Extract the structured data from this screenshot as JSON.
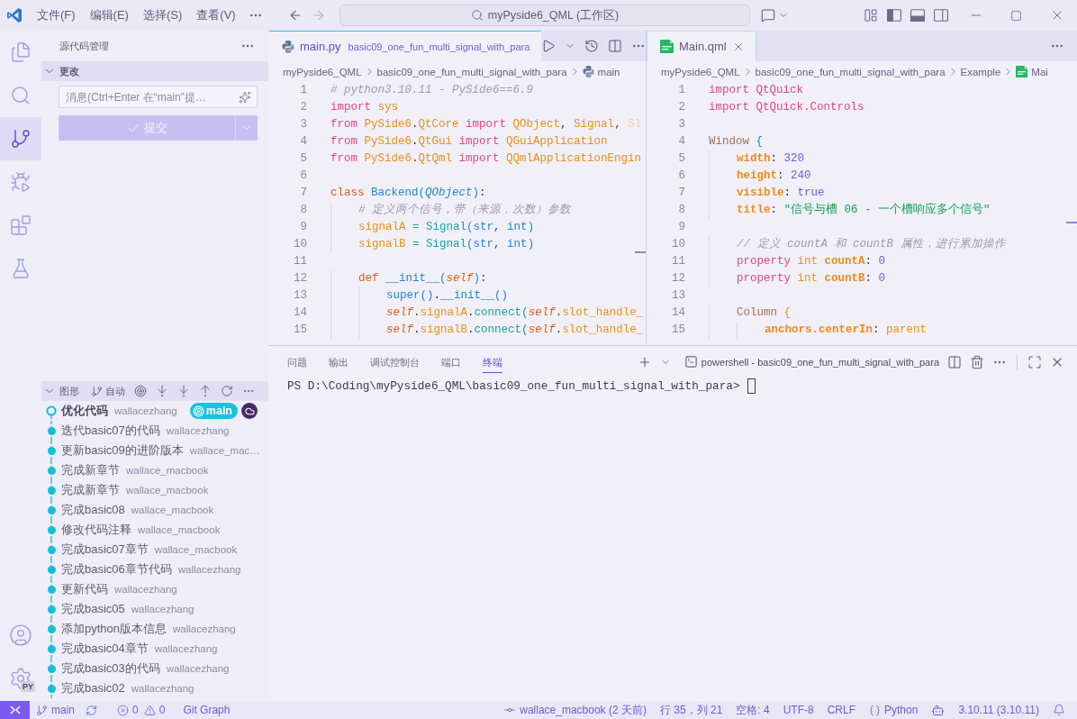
{
  "title_bar": {
    "menus": [
      "文件(F)",
      "编辑(E)",
      "选择(S)",
      "查看(V)"
    ],
    "search": "myPyside6_QML (工作区)"
  },
  "activity_bar": {
    "items": [
      {
        "kind": "explorer",
        "selected": false
      },
      {
        "kind": "search",
        "selected": false
      },
      {
        "kind": "source-control",
        "selected": true
      },
      {
        "kind": "run-debug",
        "selected": false
      },
      {
        "kind": "extensions",
        "selected": false
      },
      {
        "kind": "testing",
        "selected": false
      }
    ],
    "settings_badge": "PY"
  },
  "sidebar": {
    "title": "源代码管理",
    "changes": {
      "label": "更改",
      "expanded": true,
      "message": {
        "placeholder": "消息(Ctrl+Enter 在“main”提…"
      },
      "commit_button": {
        "label": "提交",
        "disabled": true
      }
    },
    "graph": {
      "label": "图形",
      "expanded": true,
      "branch_filter": "自动",
      "commits": [
        {
          "message": "优化代码",
          "author": "wallacezhang",
          "head": true,
          "refs": [
            {
              "kind": "branch",
              "label": "main"
            },
            {
              "kind": "remote"
            }
          ]
        },
        {
          "message": "迭代basic07的代码",
          "author": "wallacezhang",
          "head": false
        },
        {
          "message": "更新basic09的进阶版本",
          "author": "wallace_mac…",
          "head": false
        },
        {
          "message": "完成新章节",
          "author": "wallace_macbook",
          "head": false
        },
        {
          "message": "完成新章节",
          "author": "wallace_macbook",
          "head": false
        },
        {
          "message": "完成basic08",
          "author": "wallace_macbook",
          "head": false
        },
        {
          "message": "修改代码注释",
          "author": "wallace_macbook",
          "head": false
        },
        {
          "message": "完成basic07章节",
          "author": "wallace_macbook",
          "head": false
        },
        {
          "message": "完成basic06章节代码",
          "author": "wallacezhang",
          "head": false
        },
        {
          "message": "更新代码",
          "author": "wallacezhang",
          "head": false
        },
        {
          "message": "完成basic05",
          "author": "wallacezhang",
          "head": false
        },
        {
          "message": "添加python版本信息",
          "author": "wallacezhang",
          "head": false
        },
        {
          "message": "完成basic04章节",
          "author": "wallacezhang",
          "head": false
        },
        {
          "message": "完成basic03的代码",
          "author": "wallacezhang",
          "head": false
        },
        {
          "message": "完成basic02",
          "author": "wallacezhang",
          "head": false
        }
      ]
    }
  },
  "editors": [
    {
      "focused": true,
      "tab": {
        "name": "main.py",
        "description": "basic09_one_fun_multi_signal_with_para",
        "kind": "python",
        "selected": true,
        "closable": false
      },
      "breadcrumbs": [
        {
          "label": "myPyside6_QML"
        },
        {
          "label": "basic09_one_fun_multi_signal_with_para"
        },
        {
          "label": "main",
          "kind": "python"
        }
      ],
      "lines": [
        {
          "number": "1",
          "tokens": [
            {
              "kind": "comment",
              "text": "# python3.10.11 - PySide6==6.9"
            }
          ]
        },
        {
          "number": "2",
          "tokens": [
            {
              "kind": "keyword",
              "text": "import "
            },
            {
              "kind": "module",
              "text": "sys"
            }
          ]
        },
        {
          "number": "3",
          "tokens": [
            {
              "kind": "keyword",
              "text": "from "
            },
            {
              "kind": "module",
              "text": "PySide6"
            },
            {
              "kind": "punct",
              "text": "."
            },
            {
              "kind": "module",
              "text": "QtCore "
            },
            {
              "kind": "keyword",
              "text": "import "
            },
            {
              "kind": "module",
              "text": "QObject"
            },
            {
              "kind": "punct",
              "text": ", "
            },
            {
              "kind": "module",
              "text": "Signal"
            },
            {
              "kind": "punct",
              "text": ", "
            },
            {
              "kind": "faded",
              "text": "Sl"
            }
          ]
        },
        {
          "number": "4",
          "tokens": [
            {
              "kind": "keyword",
              "text": "from "
            },
            {
              "kind": "module",
              "text": "PySide6"
            },
            {
              "kind": "punct",
              "text": "."
            },
            {
              "kind": "module",
              "text": "QtGui "
            },
            {
              "kind": "keyword",
              "text": "import "
            },
            {
              "kind": "module",
              "text": "QGuiApplication"
            }
          ]
        },
        {
          "number": "5",
          "tokens": [
            {
              "kind": "keyword",
              "text": "from "
            },
            {
              "kind": "module",
              "text": "PySide6"
            },
            {
              "kind": "punct",
              "text": "."
            },
            {
              "kind": "module",
              "text": "QtQml "
            },
            {
              "kind": "keyword",
              "text": "import "
            },
            {
              "kind": "module",
              "text": "QQmlApplicationEngin"
            }
          ]
        },
        {
          "number": "6"
        },
        {
          "number": "7",
          "tokens": [
            {
              "kind": "storage",
              "text": "class "
            },
            {
              "kind": "classname",
              "text": "Backend"
            },
            {
              "kind": "paren",
              "text": "("
            },
            {
              "kind": "type",
              "text": "QObject"
            },
            {
              "kind": "paren",
              "text": ")"
            },
            {
              "kind": "punct",
              "text": ":"
            }
          ]
        },
        {
          "number": "8",
          "tokens": [
            {
              "kind": "comment",
              "text": "    # 定义两个信号，带（来源，次数）参数"
            }
          ]
        },
        {
          "number": "9",
          "tokens": [
            {
              "kind": "variable",
              "text": "    signalA"
            },
            {
              "kind": "operator",
              "text": " = "
            },
            {
              "kind": "function",
              "text": "Signal"
            },
            {
              "kind": "paren",
              "text": "("
            },
            {
              "kind": "builtin",
              "text": "str"
            },
            {
              "kind": "punct",
              "text": ", "
            },
            {
              "kind": "builtin",
              "text": "int"
            },
            {
              "kind": "paren",
              "text": ")"
            }
          ]
        },
        {
          "number": "10",
          "tokens": [
            {
              "kind": "variable",
              "text": "    signalB"
            },
            {
              "kind": "operator",
              "text": " = "
            },
            {
              "kind": "function",
              "text": "Signal"
            },
            {
              "kind": "paren",
              "text": "("
            },
            {
              "kind": "builtin",
              "text": "str"
            },
            {
              "kind": "punct",
              "text": ", "
            },
            {
              "kind": "builtin",
              "text": "int"
            },
            {
              "kind": "paren",
              "text": ")"
            }
          ]
        },
        {
          "number": "11"
        },
        {
          "number": "12",
          "tokens": [
            {
              "kind": "storage",
              "text": "    def "
            },
            {
              "kind": "builtin",
              "text": "__init__"
            },
            {
              "kind": "paren",
              "text": "("
            },
            {
              "kind": "self",
              "text": "self"
            },
            {
              "kind": "paren",
              "text": ")"
            },
            {
              "kind": "punct",
              "text": ":"
            }
          ]
        },
        {
          "number": "13",
          "tokens": [
            {
              "kind": "builtin",
              "text": "        super"
            },
            {
              "kind": "paren",
              "text": "()"
            },
            {
              "kind": "punct",
              "text": "."
            },
            {
              "kind": "builtin",
              "text": "__init__"
            },
            {
              "kind": "paren",
              "text": "()"
            }
          ]
        },
        {
          "number": "14",
          "tokens": [
            {
              "kind": "self",
              "text": "        self"
            },
            {
              "kind": "punct",
              "text": "."
            },
            {
              "kind": "variable",
              "text": "signalA"
            },
            {
              "kind": "punct",
              "text": "."
            },
            {
              "kind": "function",
              "text": "connect"
            },
            {
              "kind": "paren",
              "text": "("
            },
            {
              "kind": "self",
              "text": "self"
            },
            {
              "kind": "punct",
              "text": "."
            },
            {
              "kind": "variable",
              "text": "slot_handle_"
            }
          ]
        },
        {
          "number": "15",
          "tokens": [
            {
              "kind": "self",
              "text": "        self"
            },
            {
              "kind": "punct",
              "text": "."
            },
            {
              "kind": "variable",
              "text": "signalB"
            },
            {
              "kind": "punct",
              "text": "."
            },
            {
              "kind": "function",
              "text": "connect"
            },
            {
              "kind": "paren",
              "text": "("
            },
            {
              "kind": "self",
              "text": "self"
            },
            {
              "kind": "punct",
              "text": "."
            },
            {
              "kind": "variable",
              "text": "slot_handle_"
            }
          ]
        }
      ]
    },
    {
      "focused": false,
      "tab": {
        "name": "Main.qml",
        "kind": "qml",
        "selected": true,
        "closable": true
      },
      "breadcrumbs": [
        {
          "label": "myPyside6_QML"
        },
        {
          "label": "basic09_one_fun_multi_signal_with_para"
        },
        {
          "label": "Example"
        },
        {
          "label": "Mai",
          "kind": "qml"
        }
      ],
      "lines": [
        {
          "number": "1",
          "tokens": [
            {
              "kind": "keyword",
              "text": "import "
            },
            {
              "kind": "namespace",
              "text": "QtQuick"
            }
          ]
        },
        {
          "number": "2",
          "tokens": [
            {
              "kind": "keyword",
              "text": "import "
            },
            {
              "kind": "namespace",
              "text": "QtQuick.Controls"
            }
          ]
        },
        {
          "number": "3"
        },
        {
          "number": "4",
          "tokens": [
            {
              "kind": "component",
              "text": "Window "
            },
            {
              "kind": "brace",
              "text": "{"
            }
          ]
        },
        {
          "number": "5",
          "tokens": [
            {
              "kind": "property",
              "text": "    width"
            },
            {
              "kind": "punct",
              "text": ": "
            },
            {
              "kind": "number",
              "text": "320"
            }
          ]
        },
        {
          "number": "6",
          "tokens": [
            {
              "kind": "property",
              "text": "    height"
            },
            {
              "kind": "punct",
              "text": ": "
            },
            {
              "kind": "number",
              "text": "240"
            }
          ]
        },
        {
          "number": "7",
          "tokens": [
            {
              "kind": "property",
              "text": "    visible"
            },
            {
              "kind": "punct",
              "text": ": "
            },
            {
              "kind": "number",
              "text": "true"
            }
          ]
        },
        {
          "number": "8",
          "tokens": [
            {
              "kind": "property",
              "text": "    title"
            },
            {
              "kind": "punct",
              "text": ": "
            },
            {
              "kind": "string",
              "text": "\"信号与槽 06 - 一个槽响应多个信号\""
            }
          ]
        },
        {
          "number": "9"
        },
        {
          "number": "10",
          "tokens": [
            {
              "kind": "comment",
              "text": "    // 定义 countA 和 countB 属性，进行累加操作"
            }
          ]
        },
        {
          "number": "11",
          "tokens": [
            {
              "kind": "keyword",
              "text": "    property "
            },
            {
              "kind": "variable",
              "text": "int "
            },
            {
              "kind": "property",
              "text": "countA"
            },
            {
              "kind": "punct",
              "text": ": "
            },
            {
              "kind": "number",
              "text": "0"
            }
          ]
        },
        {
          "number": "12",
          "tokens": [
            {
              "kind": "keyword",
              "text": "    property "
            },
            {
              "kind": "variable",
              "text": "int "
            },
            {
              "kind": "property",
              "text": "countB"
            },
            {
              "kind": "punct",
              "text": ": "
            },
            {
              "kind": "number",
              "text": "0"
            }
          ]
        },
        {
          "number": "13"
        },
        {
          "number": "14",
          "tokens": [
            {
              "kind": "component",
              "text": "    Column "
            },
            {
              "kind": "brace_nested",
              "text": "{"
            }
          ]
        },
        {
          "number": "15",
          "tokens": [
            {
              "kind": "property",
              "text": "        anchors.centerIn"
            },
            {
              "kind": "punct",
              "text": ": "
            },
            {
              "kind": "variable",
              "text": "parent"
            }
          ]
        }
      ]
    }
  ],
  "panel": {
    "tabs": [
      {
        "label": "问题",
        "selected": false
      },
      {
        "label": "输出",
        "selected": false
      },
      {
        "label": "调试控制台",
        "selected": false
      },
      {
        "label": "端口",
        "selected": false
      },
      {
        "label": "终端",
        "selected": true
      }
    ],
    "terminal": {
      "name": "powershell - basic09_one_fun_multi_signal_with_para",
      "prompt": "PS D:\\Coding\\myPyside6_QML\\basic09_one_fun_multi_signal_with_para>"
    }
  },
  "status_bar": {
    "branch": "main",
    "errors": "0",
    "warnings": "0",
    "git_graph": "Git Graph",
    "last_commit": "wallace_macbook (2 天前)",
    "cursor": "行 35，列 21",
    "indentation": "空格: 4",
    "encoding": "UTF-8",
    "line_ending": "CRLF",
    "language": "Python",
    "interpreter": "3.10.11 (3.10.11)"
  }
}
